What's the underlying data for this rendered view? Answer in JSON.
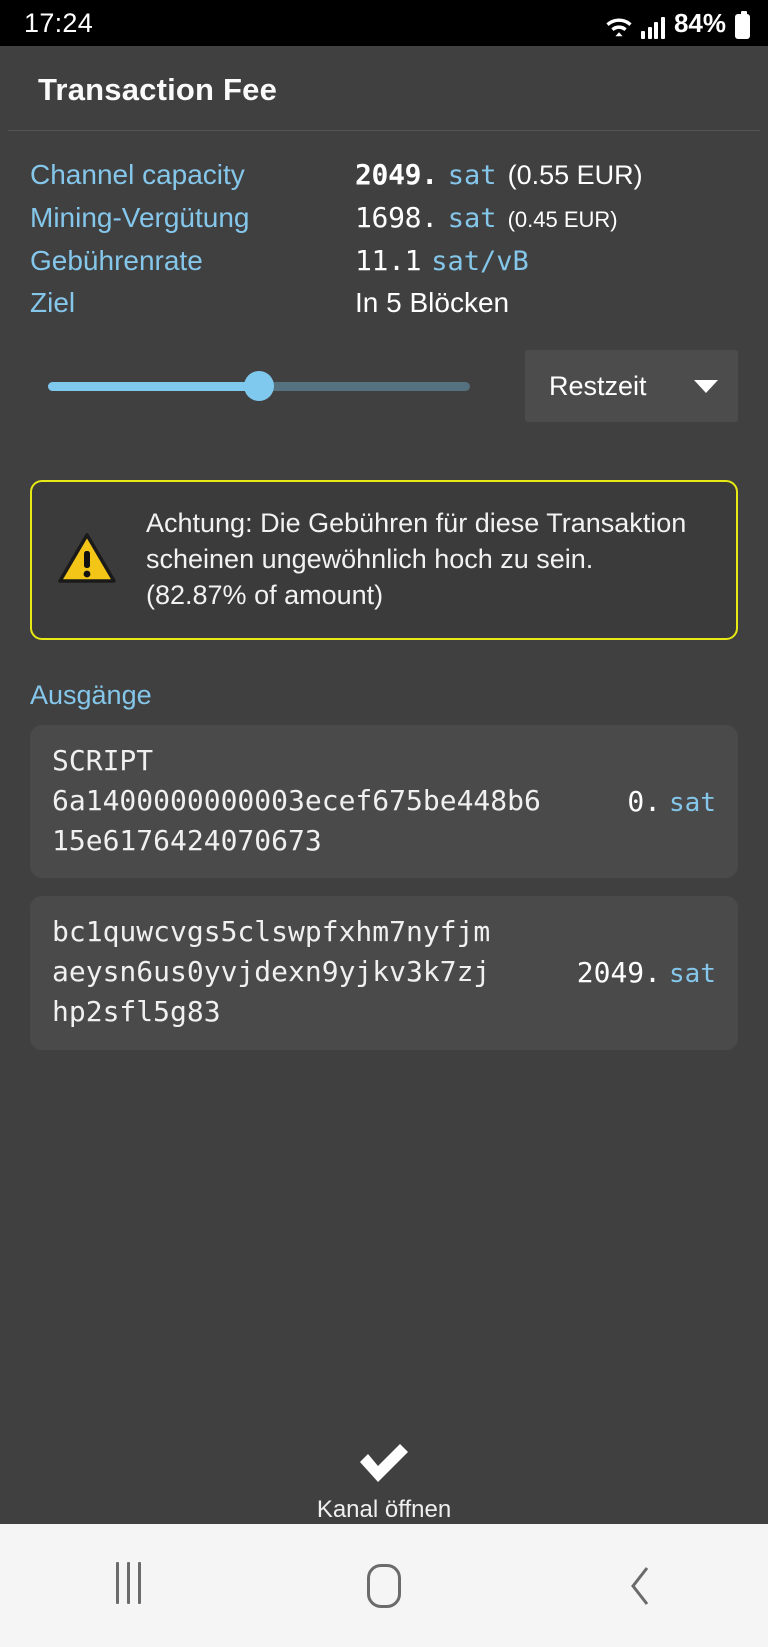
{
  "status_bar": {
    "time": "17:24",
    "battery_percent": "84%",
    "icons": [
      "wifi-icon",
      "cellular-signal-icon",
      "battery-icon"
    ]
  },
  "app_bar": {
    "title": "Transaction Fee"
  },
  "details": [
    {
      "label": "Channel capacity",
      "amount": "2049.",
      "unit": "sat",
      "fiat": "(0.55 EUR)",
      "bold": true,
      "fiat_small": false
    },
    {
      "label": "Mining-Vergütung",
      "amount": "1698.",
      "unit": "sat",
      "fiat": "(0.45 EUR)",
      "bold": false,
      "fiat_small": true
    },
    {
      "label": "Gebührenrate",
      "amount": "11.1",
      "unit": "sat/vB",
      "fiat": "",
      "bold": false,
      "fiat_small": false
    },
    {
      "label": "Ziel",
      "plain_value": "In 5 Blöcken"
    }
  ],
  "slider": {
    "name": "fee-rate-slider",
    "value_percent": 50,
    "fill_color": "#7fc9ef",
    "track_color": "#55707e"
  },
  "dropdown": {
    "selected": "Restzeit",
    "icon": "chevron-down-icon"
  },
  "warning": {
    "icon": "warning-triangle-icon",
    "border_color": "#e8e815",
    "text": "Achtung: Die Gebühren für diese Transaktion scheinen ungewöhnlich hoch zu sein. (82.87% of amount)",
    "line1": "Achtung: Die Gebühren für diese Transaktion",
    "line2": "scheinen ungewöhnlich hoch zu sein.",
    "line3": "(82.87% of amount)"
  },
  "outputs": {
    "section_title": "Ausgänge",
    "items": [
      {
        "type_label": "SCRIPT",
        "content_line1": "6a1400000000003ecef675be448b6",
        "content_line2": "15e6176424070673",
        "amount": "0.",
        "unit": "sat"
      },
      {
        "type_label": "",
        "content_line1": "bc1quwcvgs5clswpfxhm7nyfjm",
        "content_line2": "aeysn6us0yvjdexn9yjkv3k7zj",
        "content_line3": "hp2sfl5g83",
        "amount": "2049.",
        "unit": "sat"
      }
    ]
  },
  "action": {
    "icon": "checkmark-icon",
    "label": "Kanal öffnen"
  },
  "nav_bar": {
    "recents": "recents-icon",
    "home": "home-icon",
    "back": "back-icon"
  },
  "colors": {
    "background": "#404040",
    "accent_blue": "#85c7eb",
    "warning_yellow": "#e8e815",
    "card": "#4a4a4a"
  }
}
